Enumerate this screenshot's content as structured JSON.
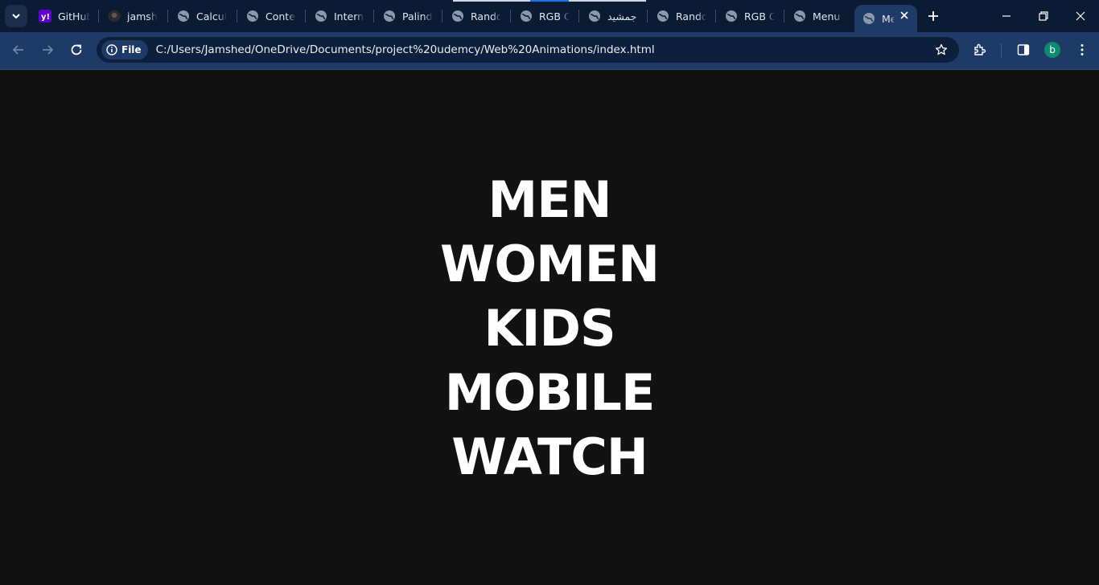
{
  "browser": {
    "tabs": [
      {
        "title": "GitHub",
        "icon": "yahoo-icon"
      },
      {
        "title": "jamshed",
        "icon": "github-icon"
      },
      {
        "title": "Calculator",
        "icon": "globe-icon"
      },
      {
        "title": "Content",
        "icon": "globe-icon"
      },
      {
        "title": "Internet",
        "icon": "globe-icon"
      },
      {
        "title": "Palindrome",
        "icon": "globe-icon"
      },
      {
        "title": "Random",
        "icon": "globe-icon"
      },
      {
        "title": "RGB Color",
        "icon": "globe-icon"
      },
      {
        "title": "جمشید",
        "icon": "globe-icon"
      },
      {
        "title": "Random",
        "icon": "globe-icon"
      },
      {
        "title": "RGB Color",
        "icon": "globe-icon"
      },
      {
        "title": "Menu",
        "icon": "globe-icon"
      },
      {
        "title": "Menu",
        "icon": "globe-icon",
        "active": true
      }
    ],
    "address": {
      "chip_label": "File",
      "url": "C:/Users/Jamshed/OneDrive/Documents/project%20udemcy/Web%20Animations/index.html"
    },
    "profile_initial": "b",
    "colors": {
      "frame": "#0b1b33",
      "toolbar": "#1e3a66",
      "page": "#121212",
      "text": "#ffffff"
    }
  },
  "page": {
    "menu": [
      "MEN",
      "WOMEN",
      "KIDS",
      "MOBILE",
      "WATCH"
    ]
  }
}
